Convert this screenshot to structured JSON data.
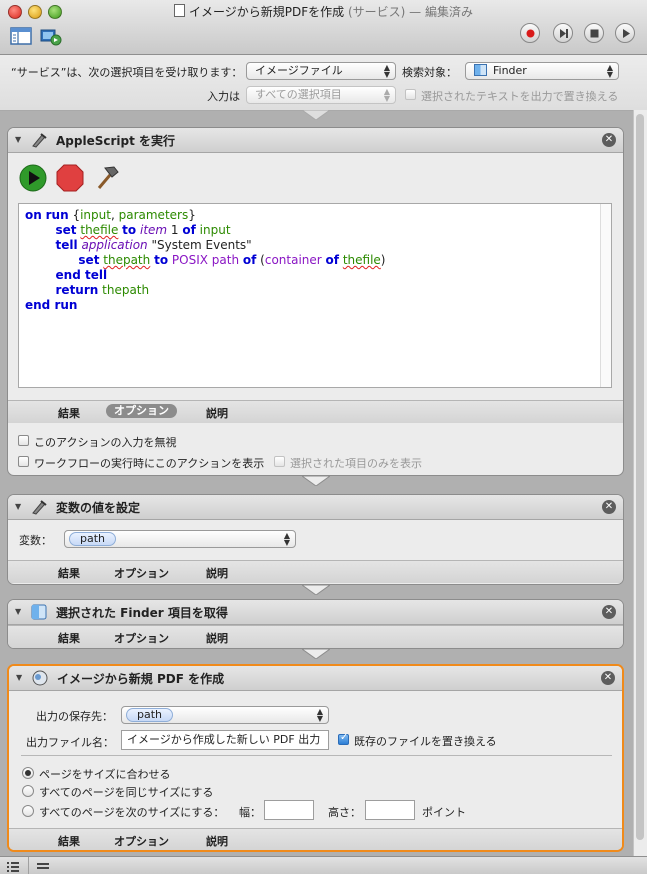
{
  "window": {
    "title": "イメージから新規PDFを作成",
    "title_suffix": "(サービス) — 編集済み"
  },
  "service": {
    "receives_label": "“サービス”は、次の選択項目を受け取ります：",
    "receives_value": "イメージファイル",
    "search_target_label": "検索対象：",
    "search_target_value": "Finder",
    "input_label": "入力は",
    "input_value": "すべての選択項目",
    "replace_text_label": "選択されたテキストを出力で置き換える"
  },
  "tabs": {
    "results": "結果",
    "options": "オプション",
    "description": "説明"
  },
  "action1": {
    "title": "AppleScript を実行",
    "ignore_input_label": "このアクションの入力を無視",
    "show_on_run_label": "ワークフローの実行時にこのアクションを表示",
    "show_selected_only_label": "選択された項目のみを表示",
    "code": {
      "l1_on": "on",
      "l1_run": "run",
      "l1_rest_open": " {",
      "l1_input": "input",
      "l1_comma": ", ",
      "l1_params": "parameters",
      "l1_close": "}",
      "l2_set": "set",
      "l2_thefile": "thefile",
      "l2_to": "to",
      "l2_item": "item",
      "l2_num": " 1 ",
      "l2_of": "of",
      "l2_input": "input",
      "l3_tell": "tell",
      "l3_application": "application",
      "l3_string": " \"System Events\"",
      "l4_set": "set",
      "l4_thepath": "thepath",
      "l4_to": "to",
      "l4_posix": "POSIX path",
      "l4_of": "of",
      "l4_paren": " (",
      "l4_container": "container",
      "l4_of2": "of",
      "l4_thefile": "thefile",
      "l4_close": ")",
      "l5_end": "end tell",
      "l6_return": "return",
      "l6_thepath": "thepath",
      "l7_end": "end run"
    }
  },
  "action2": {
    "title": "変数の値を設定",
    "variable_label": "変数：",
    "variable_value": "path"
  },
  "action3": {
    "title": "選択された Finder 項目を取得"
  },
  "action4": {
    "title": "イメージから新規 PDF を作成",
    "save_to_label": "出力の保存先：",
    "save_to_value": "path",
    "filename_label": "出力ファイル名：",
    "filename_value": "イメージから作成した新しい PDF 出力",
    "replace_existing_label": "既存のファイルを置き換える",
    "radio_fit": "ページをサイズに合わせる",
    "radio_same": "すべてのページを同じサイズにする",
    "radio_size": "すべてのページを次のサイズにする：",
    "width_label": "幅：",
    "height_label": "高さ：",
    "points_label": "ポイント"
  },
  "colors": {
    "selected_border": "#f08a1a",
    "keyword": "#0000d4",
    "variable": "#2c8a00",
    "application": "#6a0fb4"
  }
}
